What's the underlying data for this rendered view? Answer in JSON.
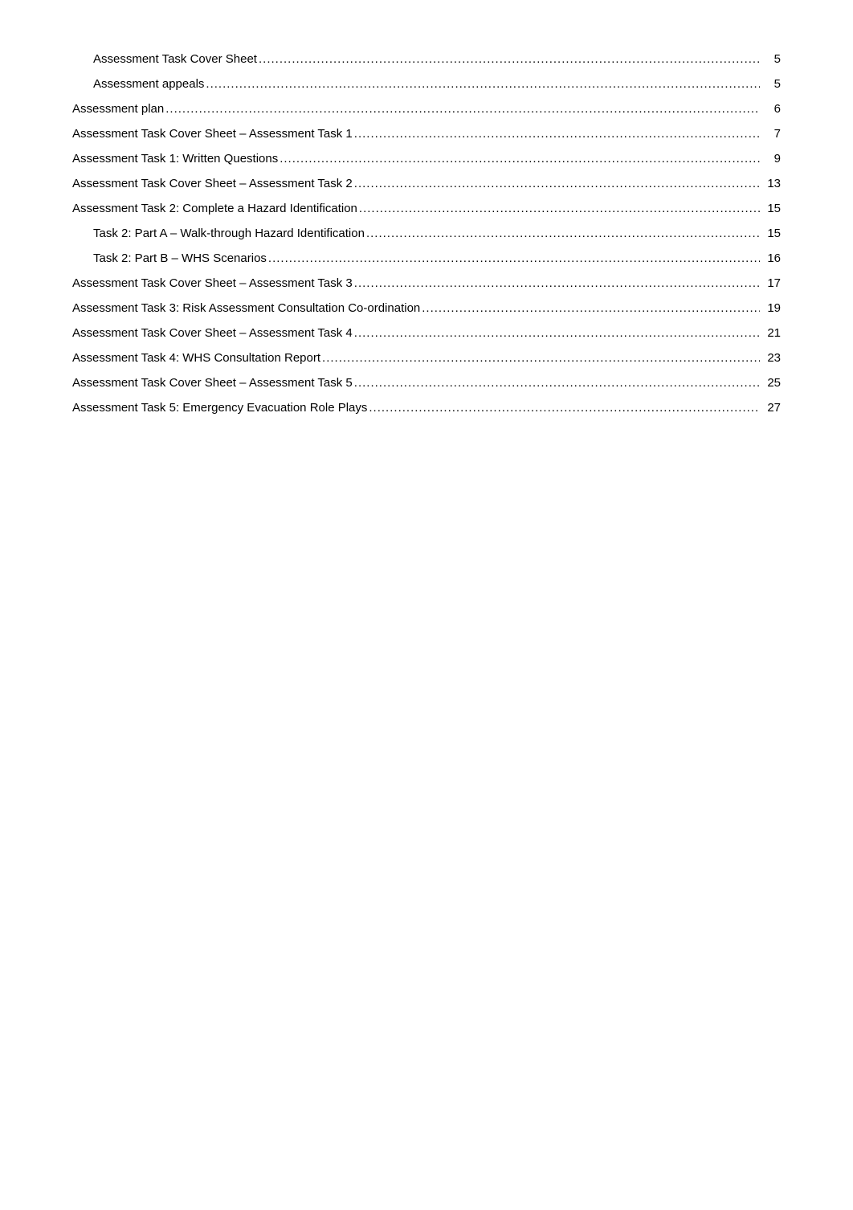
{
  "toc": {
    "items": [
      {
        "title": "Assessment Task Cover Sheet",
        "page": "5",
        "indent": 1
      },
      {
        "title": "Assessment appeals",
        "page": "5",
        "indent": 1
      },
      {
        "title": "Assessment plan",
        "page": "6",
        "indent": 0
      },
      {
        "title": "Assessment Task Cover Sheet – Assessment Task 1",
        "page": "7",
        "indent": 0
      },
      {
        "title": "Assessment Task 1: Written Questions",
        "page": "9",
        "indent": 0
      },
      {
        "title": "Assessment Task Cover Sheet – Assessment Task 2",
        "page": "13",
        "indent": 0
      },
      {
        "title": "Assessment Task 2: Complete a Hazard Identification",
        "page": "15",
        "indent": 0
      },
      {
        "title": "Task 2: Part A – Walk-through Hazard Identification",
        "page": "15",
        "indent": 1
      },
      {
        "title": "Task 2: Part B – WHS Scenarios",
        "page": "16",
        "indent": 1
      },
      {
        "title": "Assessment Task Cover Sheet – Assessment Task 3",
        "page": "17",
        "indent": 0
      },
      {
        "title": "Assessment Task 3: Risk Assessment Consultation Co-ordination",
        "page": "19",
        "indent": 0
      },
      {
        "title": "Assessment Task Cover Sheet – Assessment Task 4",
        "page": "21",
        "indent": 0
      },
      {
        "title": "Assessment Task 4: WHS Consultation Report",
        "page": "23",
        "indent": 0
      },
      {
        "title": "Assessment Task Cover Sheet – Assessment Task 5",
        "page": "25",
        "indent": 0
      },
      {
        "title": "Assessment Task 5: Emergency Evacuation Role Plays",
        "page": "27",
        "indent": 0
      }
    ]
  }
}
